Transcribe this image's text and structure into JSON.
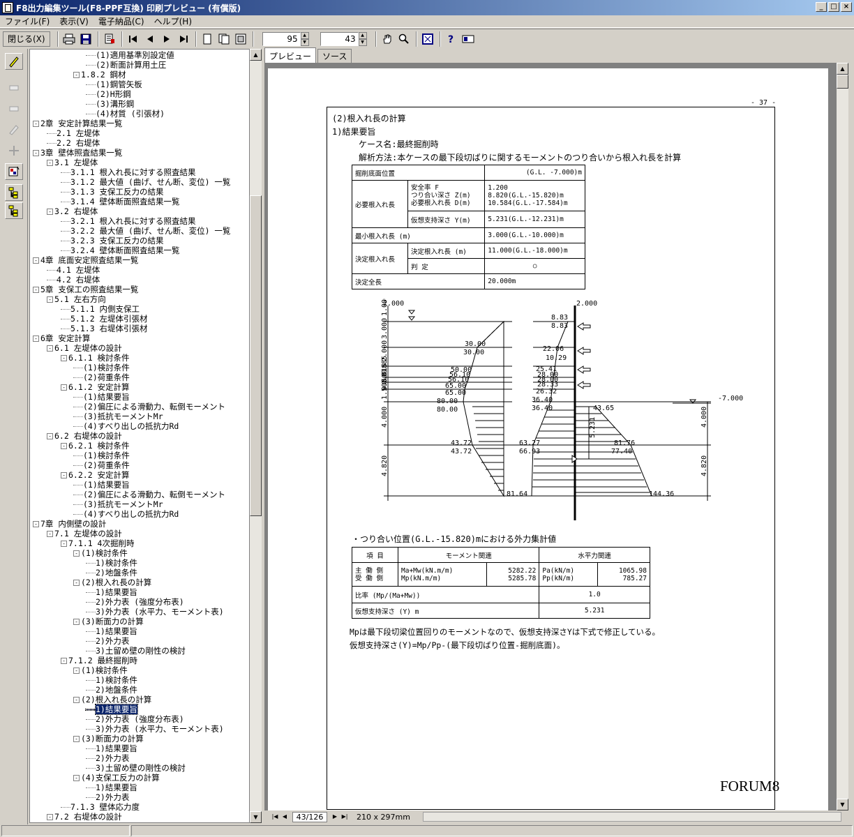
{
  "window": {
    "title": "F8出力編集ツール(F8-PPF互換) 印刷プレビュー (有償版)"
  },
  "menu": [
    "ファイル(F)",
    "表示(V)",
    "電子納品(C)",
    "ヘルプ(H)"
  ],
  "toolbar": {
    "close_label": "閉じる(X)",
    "page_zoom": "95",
    "page_num_field": "43"
  },
  "tabs": [
    "プレビュー",
    "ソース"
  ],
  "tree": [
    {
      "d": 4,
      "t": "(1)適用基準別設定値"
    },
    {
      "d": 4,
      "t": "(2)断面計算用土圧"
    },
    {
      "d": 3,
      "t": "1.8.2 鋼材",
      "box": "-"
    },
    {
      "d": 4,
      "t": "(1)鋼管矢板"
    },
    {
      "d": 4,
      "t": "(2)H形鋼"
    },
    {
      "d": 4,
      "t": "(3)溝形鋼"
    },
    {
      "d": 4,
      "t": "(4)材質 (引張材)"
    },
    {
      "d": 0,
      "t": "2章 安定計算結果一覧",
      "box": "-"
    },
    {
      "d": 1,
      "t": "2.1 左堤体"
    },
    {
      "d": 1,
      "t": "2.2 右堤体"
    },
    {
      "d": 0,
      "t": "3章 壁体照査結果一覧",
      "box": "-"
    },
    {
      "d": 1,
      "t": "3.1 左堤体",
      "box": "-"
    },
    {
      "d": 2,
      "t": "3.1.1 根入れ長に対する照査結果"
    },
    {
      "d": 2,
      "t": "3.1.2 最大値 (曲げ、せん断、変位) 一覧"
    },
    {
      "d": 2,
      "t": "3.1.3 支保工反力の結果"
    },
    {
      "d": 2,
      "t": "3.1.4 壁体断面照査結果一覧"
    },
    {
      "d": 1,
      "t": "3.2 右堤体",
      "box": "-"
    },
    {
      "d": 2,
      "t": "3.2.1 根入れ長に対する照査結果"
    },
    {
      "d": 2,
      "t": "3.2.2 最大値 (曲げ、せん断、変位) 一覧"
    },
    {
      "d": 2,
      "t": "3.2.3 支保工反力の結果"
    },
    {
      "d": 2,
      "t": "3.2.4 壁体断面照査結果一覧"
    },
    {
      "d": 0,
      "t": "4章 底面安定照査結果一覧",
      "box": "-"
    },
    {
      "d": 1,
      "t": "4.1 左堤体"
    },
    {
      "d": 1,
      "t": "4.2 右堤体"
    },
    {
      "d": 0,
      "t": "5章 支保工の照査結果一覧",
      "box": "-"
    },
    {
      "d": 1,
      "t": "5.1 左右方向",
      "box": "-"
    },
    {
      "d": 2,
      "t": "5.1.1 内側支保工"
    },
    {
      "d": 2,
      "t": "5.1.2 左堤体引張材"
    },
    {
      "d": 2,
      "t": "5.1.3 右堤体引張材"
    },
    {
      "d": 0,
      "t": "6章 安定計算",
      "box": "-"
    },
    {
      "d": 1,
      "t": "6.1 左堤体の設計",
      "box": "-"
    },
    {
      "d": 2,
      "t": "6.1.1 検討条件",
      "box": "-"
    },
    {
      "d": 3,
      "t": "(1)検討条件"
    },
    {
      "d": 3,
      "t": "(2)荷重条件"
    },
    {
      "d": 2,
      "t": "6.1.2 安定計算",
      "box": "-"
    },
    {
      "d": 3,
      "t": "(1)結果要旨"
    },
    {
      "d": 3,
      "t": "(2)偏圧による滑動力、転倒モーメント"
    },
    {
      "d": 3,
      "t": "(3)抵抗モーメントMr"
    },
    {
      "d": 3,
      "t": "(4)すべり出しの抵抗力Rd"
    },
    {
      "d": 1,
      "t": "6.2 右堤体の設計",
      "box": "-"
    },
    {
      "d": 2,
      "t": "6.2.1 検討条件",
      "box": "-"
    },
    {
      "d": 3,
      "t": "(1)検討条件"
    },
    {
      "d": 3,
      "t": "(2)荷重条件"
    },
    {
      "d": 2,
      "t": "6.2.2 安定計算",
      "box": "-"
    },
    {
      "d": 3,
      "t": "(1)結果要旨"
    },
    {
      "d": 3,
      "t": "(2)偏圧による滑動力、転倒モーメント"
    },
    {
      "d": 3,
      "t": "(3)抵抗モーメントMr"
    },
    {
      "d": 3,
      "t": "(4)すべり出しの抵抗力Rd"
    },
    {
      "d": 0,
      "t": "7章 内側壁の設計",
      "box": "-"
    },
    {
      "d": 1,
      "t": "7.1 左堤体の設計",
      "box": "-"
    },
    {
      "d": 2,
      "t": "7.1.1 4次掘削時",
      "box": "-"
    },
    {
      "d": 3,
      "t": "(1)検討条件",
      "box": "-"
    },
    {
      "d": 4,
      "t": "1)検討条件"
    },
    {
      "d": 4,
      "t": "2)地盤条件"
    },
    {
      "d": 3,
      "t": "(2)根入れ長の計算",
      "box": "-"
    },
    {
      "d": 4,
      "t": "1)結果要旨"
    },
    {
      "d": 4,
      "t": "2)外力表 (強度分布表)"
    },
    {
      "d": 4,
      "t": "3)外力表 (水平力、モーメント表)"
    },
    {
      "d": 3,
      "t": "(3)断面力の計算",
      "box": "-"
    },
    {
      "d": 4,
      "t": "1)結果要旨"
    },
    {
      "d": 4,
      "t": "2)外力表"
    },
    {
      "d": 4,
      "t": "3)土留め壁の剛性の検討"
    },
    {
      "d": 2,
      "t": "7.1.2 最終掘削時",
      "box": "-"
    },
    {
      "d": 3,
      "t": "(1)検討条件",
      "box": "-"
    },
    {
      "d": 4,
      "t": "1)検討条件"
    },
    {
      "d": 4,
      "t": "2)地盤条件"
    },
    {
      "d": 3,
      "t": "(2)根入れ長の計算",
      "box": "-"
    },
    {
      "d": 4,
      "t": "1)結果要旨",
      "sel": true
    },
    {
      "d": 4,
      "t": "2)外力表 (強度分布表)"
    },
    {
      "d": 4,
      "t": "3)外力表 (水平力、モーメント表)"
    },
    {
      "d": 3,
      "t": "(3)断面力の計算",
      "box": "-"
    },
    {
      "d": 4,
      "t": "1)結果要旨"
    },
    {
      "d": 4,
      "t": "2)外力表"
    },
    {
      "d": 4,
      "t": "3)土留め壁の剛性の検討"
    },
    {
      "d": 3,
      "t": "(4)支保工反力の計算",
      "box": "-"
    },
    {
      "d": 4,
      "t": "1)結果要旨"
    },
    {
      "d": 4,
      "t": "2)外力表"
    },
    {
      "d": 2,
      "t": "7.1.3 壁体応力度"
    },
    {
      "d": 1,
      "t": "7.2 右堤体の設計",
      "box": "-"
    }
  ],
  "page": {
    "page_number": "- 37 -",
    "heading1": "(2)根入れ長の計算",
    "heading2": "1)結果要旨",
    "case_name": "ケース名:最終掘削時",
    "method": "解析方法:本ケースの最下段切ばりに関するモーメントのつり合いから根入れ長を計算",
    "result_table": {
      "r1_label": "掘削底面位置",
      "r1_value": "(G.L. -7.000)m",
      "r2_label": "必要根入れ長",
      "r2_sub1": "安全率 F\nつり合い深さ Z(m)\n必要根入れ長 D(m)",
      "r2_val1": "1.200\n8.820(G.L.-15.820)m\n10.584(G.L.-17.584)m",
      "r2_sub2": "仮想支持深さ Y(m)",
      "r2_val2": "5.231(G.L.-12.231)m",
      "r3_label": "最小根入れ長 (m)",
      "r3_value": "3.000(G.L.-10.000)m",
      "r4_label": "決定根入れ長",
      "r4_sub1": "決定根入れ長 (m)",
      "r4_val1": "11.000(G.L.-18.000)m",
      "r4_sub2": "判 定",
      "r4_val2": "○",
      "r5_label": "決定全長",
      "r5_value": "20.000m"
    },
    "diagram_labels": {
      "top_left": "2.000",
      "top_right": "2.000",
      "excavation": "-7.000",
      "dims_left": [
        "1.000",
        "3.000",
        "2.000",
        "0.885",
        "0.615",
        "0.500",
        "1.500",
        "4.000",
        "4.820"
      ],
      "dims_right": [
        "4.000",
        "4.820"
      ],
      "y_dim": "5.231",
      "left_values": [
        "30.00",
        "30.00",
        "50.00",
        "56.10",
        "56.10",
        "65.00",
        "65.00",
        "80.00",
        "80.00",
        "43.72",
        "43.72",
        "81.64"
      ],
      "right_values": [
        "8.83",
        "8.83",
        "22.06",
        "10.29",
        "25.41",
        "28.00",
        "28.00",
        "28.33",
        "26.32",
        "36.40",
        "36.40",
        "43.65",
        "63.27",
        "66.93",
        "81.76",
        "77.40",
        "144.36"
      ]
    },
    "ext_heading": "・つり合い位置(G.L.-15.820)mにおける外力集計値",
    "ext_table": {
      "h1": "項 目",
      "h2": "モーメント関連",
      "h3": "水平力関連",
      "r1_label": "主 働 側\n受 働 側",
      "r1_m_label": "Ma+Mw(kN.m/m)\nMp(kN.m/m)",
      "r1_m_val": "5282.22\n5285.78",
      "r1_h_label": "Pa(kN/m)\nPp(kN/m)",
      "r1_h_val": "1065.98\n785.27",
      "r2_label": "比率 (Mp/(Ma+Mw))",
      "r2_val": "1.0",
      "r3_label": "仮想支持深さ (Y) m",
      "r3_val": "5.231"
    },
    "note1": "Mpは最下段切梁位置回りのモーメントなので、仮想支持深さYは下式で修正している。",
    "note2": "仮想支持深さ(Y)=Mp/Pp-(最下段切ばり位置-掘削底面)。",
    "logo": "FORUM8"
  },
  "pagenav": {
    "current": "43/126",
    "paper": "210 x 297mm"
  }
}
